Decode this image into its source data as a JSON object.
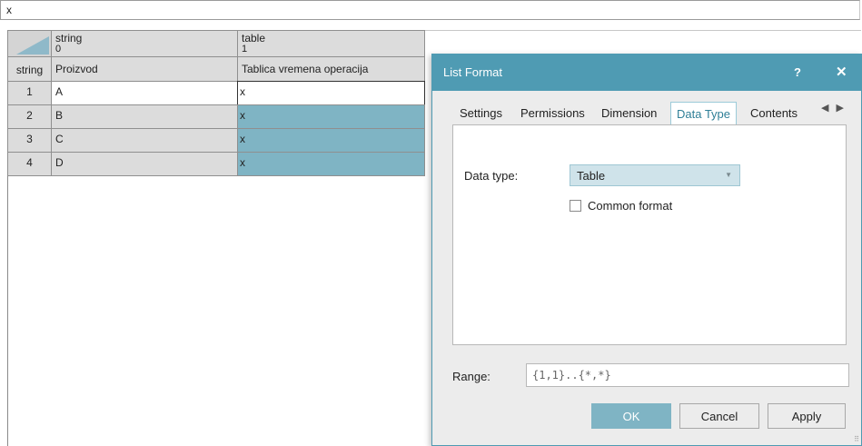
{
  "formula_bar": {
    "value": "x"
  },
  "grid": {
    "columns": [
      {
        "name": "string",
        "index": "0"
      },
      {
        "name": "table",
        "index": "1"
      }
    ],
    "header_row": {
      "label": "string",
      "cells": [
        "Proizvod",
        "Tablica vremena operacija"
      ]
    },
    "rows": [
      {
        "num": "1",
        "cells": [
          "A",
          "x"
        ]
      },
      {
        "num": "2",
        "cells": [
          "B",
          "x"
        ]
      },
      {
        "num": "3",
        "cells": [
          "C",
          "x"
        ]
      },
      {
        "num": "4",
        "cells": [
          "D",
          "x"
        ]
      }
    ]
  },
  "dialog": {
    "title": "List Format",
    "help": "?",
    "close": "✕",
    "tabs": [
      "Settings",
      "Permissions",
      "Dimension",
      "Data Type",
      "Contents"
    ],
    "active_tab": "Data Type",
    "data_type_label": "Data type:",
    "data_type_value": "Table",
    "common_format_label": "Common format",
    "common_format_checked": false,
    "range_label": "Range:",
    "range_value": "{1,1}..{*,*}",
    "buttons": {
      "ok": "OK",
      "cancel": "Cancel",
      "apply": "Apply"
    }
  },
  "colors": {
    "accent": "#4f9bb3",
    "selection": "#7fb4c4"
  }
}
